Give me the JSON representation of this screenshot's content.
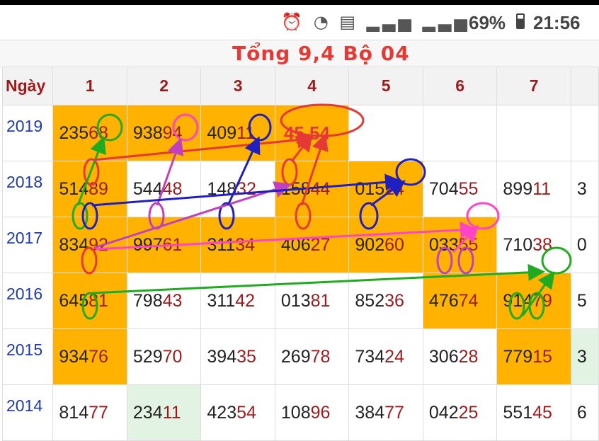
{
  "status_bar": {
    "battery": "69%",
    "time": "21:56"
  },
  "table": {
    "title": "Tổng 9,4 Bộ 04",
    "headers": [
      "Ngày",
      "1",
      "2",
      "3",
      "4",
      "5",
      "6",
      "7",
      ""
    ],
    "rows": [
      {
        "year": "2019",
        "cells": [
          [
            "235",
            "68"
          ],
          [
            "938",
            "94"
          ],
          [
            "409",
            "11"
          ],
          [
            "45,54",
            ""
          ],
          [
            "",
            ""
          ],
          [
            "",
            ""
          ],
          [
            "",
            ""
          ],
          [
            "",
            ""
          ]
        ]
      },
      {
        "year": "2018",
        "cells": [
          [
            "514",
            "89"
          ],
          [
            "544",
            "48"
          ],
          [
            "148",
            "32"
          ],
          [
            "158",
            "44"
          ],
          [
            "015",
            "24"
          ],
          [
            "704",
            "55"
          ],
          [
            "899",
            "11"
          ],
          [
            "3",
            ""
          ]
        ]
      },
      {
        "year": "2017",
        "cells": [
          [
            "834",
            "92"
          ],
          [
            "997",
            "61"
          ],
          [
            "311",
            "34"
          ],
          [
            "406",
            "27"
          ],
          [
            "902",
            "60"
          ],
          [
            "033",
            "55"
          ],
          [
            "710",
            "38"
          ],
          [
            "0",
            ""
          ]
        ]
      },
      {
        "year": "2016",
        "cells": [
          [
            "645",
            "81"
          ],
          [
            "798",
            "43"
          ],
          [
            "311",
            "42"
          ],
          [
            "013",
            "81"
          ],
          [
            "852",
            "36"
          ],
          [
            "476",
            "74"
          ],
          [
            "914",
            "79"
          ],
          [
            "5",
            ""
          ]
        ]
      },
      {
        "year": "2015",
        "cells": [
          [
            "934",
            "76"
          ],
          [
            "529",
            "70"
          ],
          [
            "394",
            "35"
          ],
          [
            "269",
            "78"
          ],
          [
            "734",
            "24"
          ],
          [
            "306",
            "28"
          ],
          [
            "779",
            "15"
          ],
          [
            "3",
            ""
          ]
        ]
      },
      {
        "year": "2014",
        "cells": [
          [
            "814",
            "77"
          ],
          [
            "234",
            "11"
          ],
          [
            "423",
            "54"
          ],
          [
            "108",
            "96"
          ],
          [
            "384",
            "77"
          ],
          [
            "042",
            "25"
          ],
          [
            "551",
            "45"
          ],
          [
            "6",
            ""
          ]
        ]
      }
    ],
    "highlight": [
      [
        "o",
        "o",
        "o",
        "o",
        "",
        "",
        "",
        ""
      ],
      [
        "o",
        "",
        "",
        "o",
        "o",
        "",
        "",
        ""
      ],
      [
        "o",
        "o",
        "o",
        "o",
        "o",
        "o",
        "",
        ""
      ],
      [
        "o",
        "",
        "",
        "",
        "",
        "o",
        "o",
        ""
      ],
      [
        "o",
        "",
        "",
        "",
        "",
        "",
        "o",
        "g"
      ],
      [
        "",
        "g",
        "",
        "",
        "",
        "",
        "",
        ""
      ]
    ]
  },
  "colors": {
    "orange": "#ffb300",
    "dark_red": "#9b1c1c",
    "year_blue": "#1e3aa8",
    "annotation_red": "#e53935"
  }
}
